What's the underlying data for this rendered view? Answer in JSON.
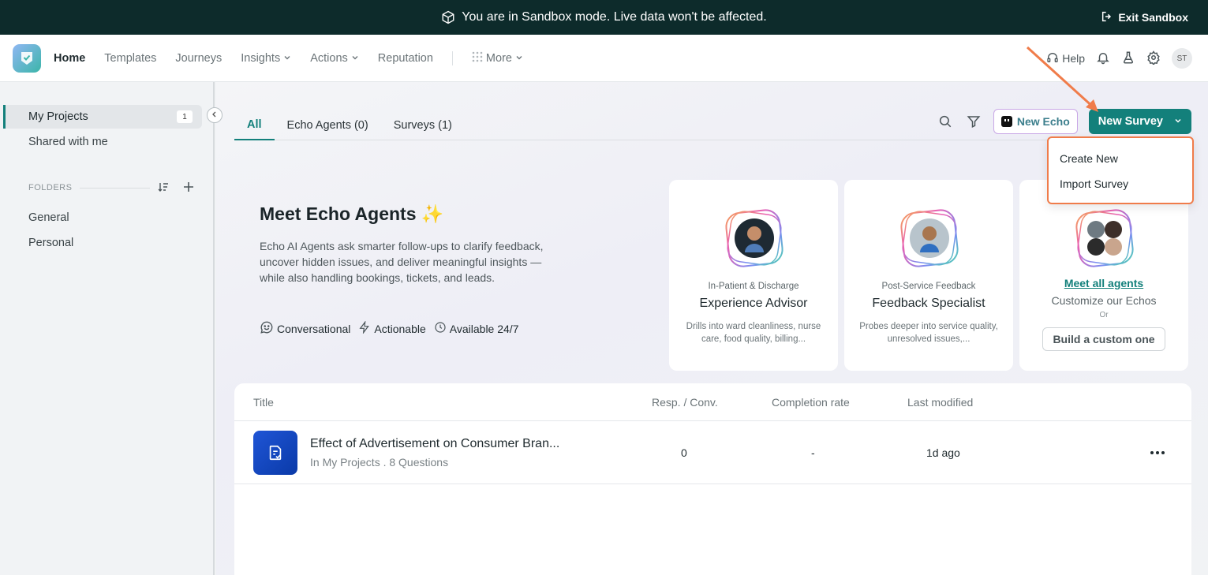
{
  "banner": {
    "message": "You are in Sandbox mode. Live data won't be affected.",
    "exit_label": "Exit Sandbox"
  },
  "nav": {
    "items": [
      {
        "label": "Home",
        "active": true
      },
      {
        "label": "Templates"
      },
      {
        "label": "Journeys"
      },
      {
        "label": "Insights",
        "dropdown": true
      },
      {
        "label": "Actions",
        "dropdown": true
      },
      {
        "label": "Reputation"
      }
    ],
    "more_label": "More",
    "help_label": "Help",
    "avatar_initials": "ST"
  },
  "sidebar": {
    "projects": [
      {
        "label": "My Projects",
        "count": "1",
        "active": true
      },
      {
        "label": "Shared with me"
      }
    ],
    "folders_header": "FOLDERS",
    "folders": [
      {
        "label": "General"
      },
      {
        "label": "Personal"
      }
    ]
  },
  "tabs": [
    {
      "label": "All",
      "active": true
    },
    {
      "label": "Echo Agents (0)"
    },
    {
      "label": "Surveys (1)"
    }
  ],
  "toolbar": {
    "new_echo_label": "New Echo",
    "new_survey_label": "New Survey"
  },
  "dropdown": {
    "items": [
      "Create New",
      "Import Survey"
    ]
  },
  "hero": {
    "title": "Meet Echo Agents",
    "sparkle": "✨",
    "description": "Echo AI Agents ask smarter follow-ups to clarify feedback, uncover hidden issues, and deliver meaningful insights — while also handling bookings, tickets, and leads.",
    "features": [
      "Conversational",
      "Actionable",
      "Available 24/7"
    ]
  },
  "agents": [
    {
      "category": "In-Patient & Discharge",
      "name": "Experience Advisor",
      "description": "Drills into ward cleanliness, nurse care, food quality, billing..."
    },
    {
      "category": "Post-Service Feedback",
      "name": "Feedback Specialist",
      "description": "Probes deeper into service quality, unresolved issues,..."
    }
  ],
  "meet_card": {
    "link": "Meet all agents",
    "subtitle": "Customize our Echos",
    "or": "Or",
    "button": "Build a custom one"
  },
  "table": {
    "headers": {
      "title": "Title",
      "resp": "Resp. / Conv.",
      "completion": "Completion rate",
      "modified": "Last modified"
    },
    "rows": [
      {
        "title": "Effect of Advertisement on Consumer Bran...",
        "subtitle": "In My Projects . 8 Questions",
        "resp": "0",
        "completion": "-",
        "modified": "1d ago"
      }
    ]
  },
  "colors": {
    "accent": "#13807b",
    "banner": "#0d2b2b",
    "highlight": "#f07c4a",
    "survey_icon": "#1f55d6"
  }
}
